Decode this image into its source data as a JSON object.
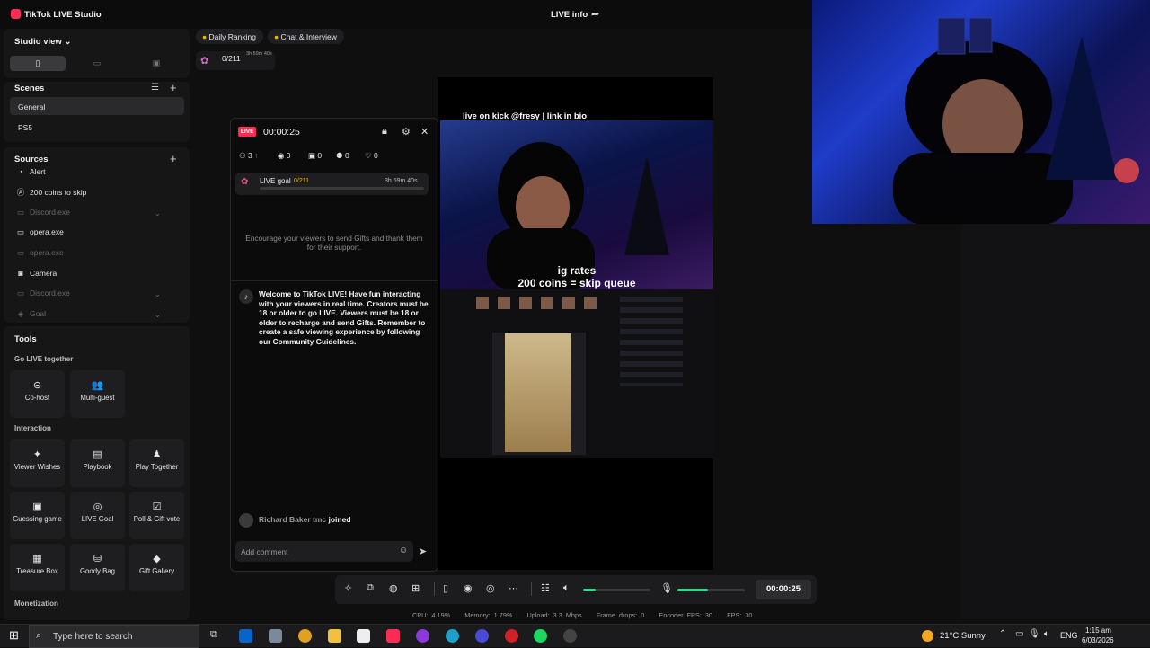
{
  "app": {
    "title": "TikTok LIVE Studio",
    "live_info": "LIVE info"
  },
  "studio_view": {
    "label": "Studio view",
    "tabs": [
      "▯",
      "▭",
      "▣"
    ]
  },
  "scenes": {
    "title": "Scenes",
    "items": [
      "General",
      "PS5"
    ]
  },
  "sources": {
    "title": "Sources",
    "items": [
      {
        "label": "Alert",
        "active": true
      },
      {
        "label": "200 coins to skip",
        "active": true
      },
      {
        "label": "Discord.exe",
        "active": false
      },
      {
        "label": "opera.exe",
        "active": true
      },
      {
        "label": "opera.exe",
        "active": false
      },
      {
        "label": "Camera",
        "active": true
      },
      {
        "label": "Discord.exe",
        "active": false
      },
      {
        "label": "Goal",
        "active": false
      }
    ]
  },
  "tools": {
    "title": "Tools",
    "go_live_together": "Go LIVE together",
    "interaction": "Interaction",
    "monetization": "Monetization",
    "cohost": "Co-host",
    "multiguest": "Multi-guest",
    "viewer_wishes": "Viewer Wishes",
    "playbook": "Playbook",
    "play_together": "Play Together",
    "guessing_game": "Guessing game",
    "live_goal": "LIVE Goal",
    "poll_gift_vote": "Poll & Gift vote",
    "treasure_box": "Treasure Box",
    "goody_bag": "Goody Bag",
    "gift_gallery": "Gift Gallery"
  },
  "top_tabs": {
    "daily_ranking": "Daily Ranking",
    "chat_interview": "Chat & Interview"
  },
  "goal_mini": {
    "count": "0/211",
    "time": "3h 59m 40s"
  },
  "dock": {
    "badge": "LIVE",
    "timer": "00:00:25",
    "stats": {
      "viewers": "3",
      "views": "0",
      "gifts": "0",
      "new_followers": "0",
      "likes": "0"
    },
    "goal": {
      "label": "LIVE goal",
      "count": "0/211",
      "time": "3h 59m 40s",
      "progress": 0
    },
    "encourage": "Encourage your viewers to send Gifts and thank them for their support.",
    "welcome": "Welcome to TikTok LIVE! Have fun interacting with your viewers in real time. Creators must be 18 or older to go LIVE. Viewers must be 18 or older to recharge and send Gifts. Remember to create a safe viewing experience by following our Community Guidelines.",
    "join_user": "Richard Baker tmc",
    "join_text": "joined",
    "comment_placeholder": "Add comment"
  },
  "canvas": {
    "top_text": "live on kick @fresy | link in bio",
    "overlay_line1": "ig rates",
    "overlay_line2": "200 coins = skip queue"
  },
  "controls": {
    "timer": "00:00:25",
    "speaker_level": 0.18,
    "mic_level": 0.45
  },
  "perf": {
    "cpu": "CPU: 4.19%",
    "memory": "Memory: 1.79%",
    "upload": "Upload: 3.3 Mbps",
    "frame_drops": "Frame drops: 0",
    "encoder_fps": "Encoder FPS: 30",
    "fps": "FPS: 30"
  },
  "taskbar": {
    "search": "Type here to search",
    "weather": "21°C Sunny",
    "lang": "ENG",
    "time": "1:15 am",
    "date": "6/03/2026"
  }
}
